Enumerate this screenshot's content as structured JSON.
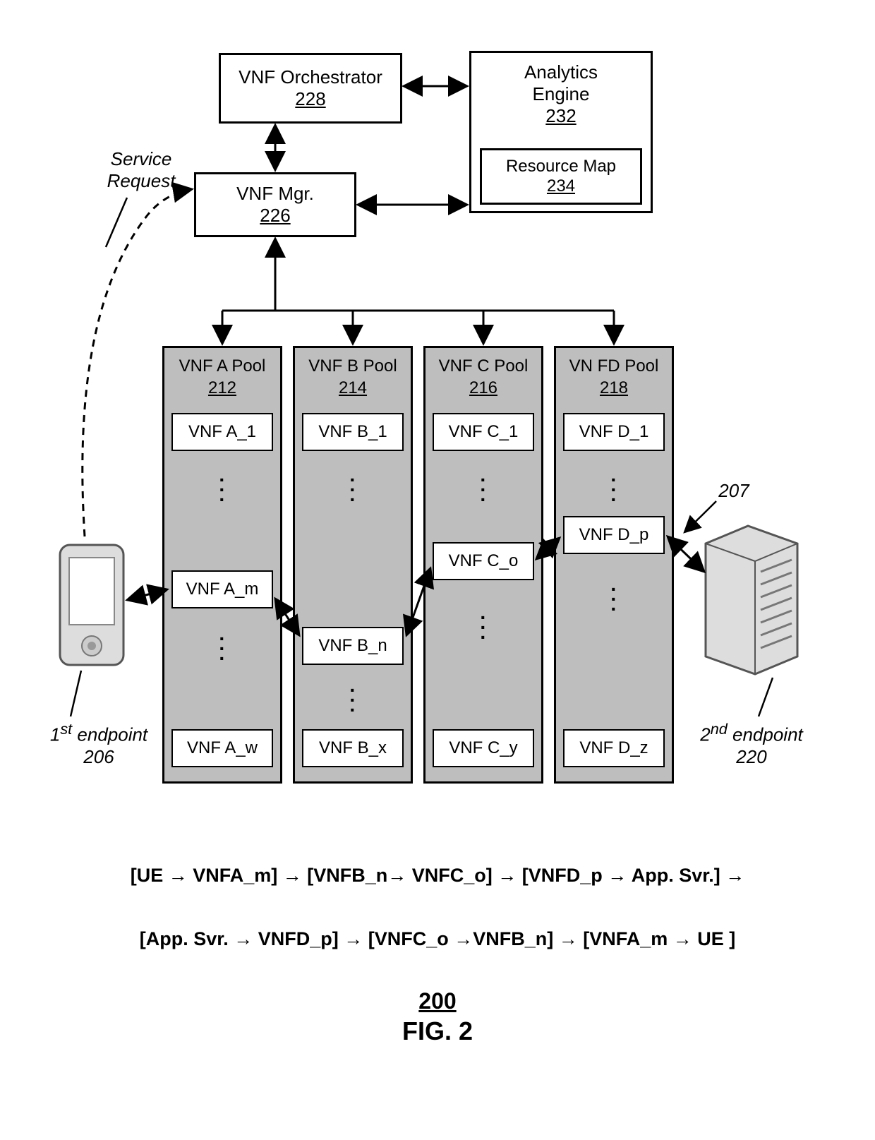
{
  "orchestrator": {
    "title": "VNF Orchestrator",
    "ref": "228"
  },
  "analytics": {
    "title": "Analytics",
    "title2": "Engine",
    "ref": "232"
  },
  "resource_map": {
    "title": "Resource Map",
    "ref": "234"
  },
  "vnf_mgr": {
    "title": "VNF Mgr.",
    "ref": "226"
  },
  "service_request": {
    "l1": "Service",
    "l2": "Request"
  },
  "pools": {
    "a": {
      "title": "VNF A Pool",
      "ref": "212",
      "items": [
        "VNF A_1",
        "VNF A_m",
        "VNF A_w"
      ]
    },
    "b": {
      "title": "VNF B Pool",
      "ref": "214",
      "items": [
        "VNF B_1",
        "VNF B_n",
        "VNF B_x"
      ]
    },
    "c": {
      "title": "VNF C Pool",
      "ref": "216",
      "items": [
        "VNF C_1",
        "VNF C_o",
        "VNF C_y"
      ]
    },
    "d": {
      "title": "VN FD Pool",
      "ref": "218",
      "items": [
        "VNF D_1",
        "VNF D_p",
        "VNF D_z"
      ]
    }
  },
  "endpoint1": {
    "l1": "1",
    "sup": "st",
    "l2": " endpoint",
    "ref": "206"
  },
  "endpoint2": {
    "l1": "2",
    "sup": "nd",
    "l2": " endpoint",
    "ref": "220"
  },
  "chain_ref": "207",
  "flow": {
    "line1": "[UE → VNFA_m] → [VNFB_n→ VNFC_o] → [VNFD_p → App. Svr.] →",
    "line2": "[App. Svr. → VNFD_p] → [VNFC_o →VNFB_n] → [VNFA_m → UE ]"
  },
  "fig": {
    "num": "200",
    "label": "FIG. 2"
  }
}
